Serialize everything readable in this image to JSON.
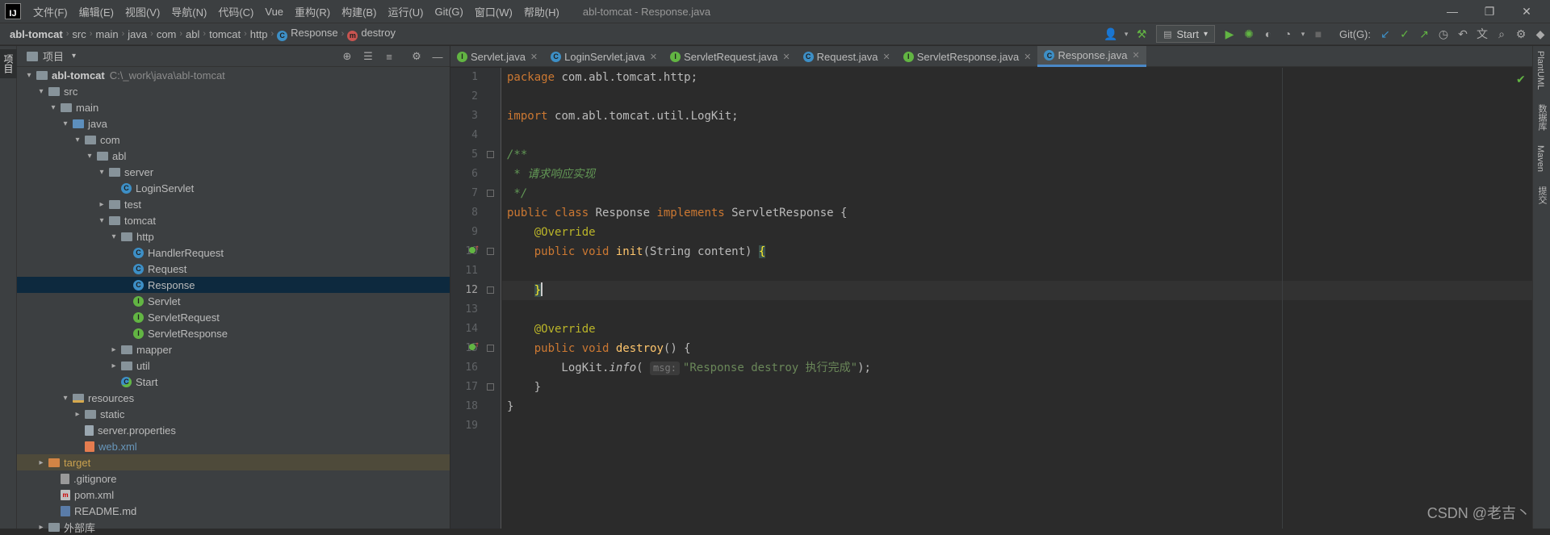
{
  "menubar": {
    "logo": "IJ",
    "items": [
      "文件(F)",
      "编辑(E)",
      "视图(V)",
      "导航(N)",
      "代码(C)",
      "Vue",
      "重构(R)",
      "构建(B)",
      "运行(U)",
      "Git(G)",
      "窗口(W)",
      "帮助(H)"
    ],
    "window_title": "abl-tomcat - Response.java"
  },
  "breadcrumb": {
    "items": [
      "abl-tomcat",
      "src",
      "main",
      "java",
      "com",
      "abl",
      "tomcat",
      "http",
      "Response",
      "destroy"
    ]
  },
  "toolbar": {
    "run_config": "Start",
    "git_label": "Git(G):"
  },
  "project_panel": {
    "title": "项目",
    "strip_label": "项目"
  },
  "tree": [
    {
      "label": "abl-tomcat",
      "hint": "C:\\_work\\java\\abl-tomcat",
      "depth": 0,
      "arrow": "▾",
      "icon": "root",
      "bold": true
    },
    {
      "label": "src",
      "depth": 1,
      "arrow": "▾",
      "icon": "folder"
    },
    {
      "label": "main",
      "depth": 2,
      "arrow": "▾",
      "icon": "folder"
    },
    {
      "label": "java",
      "depth": 3,
      "arrow": "▾",
      "icon": "folder-blue"
    },
    {
      "label": "com",
      "depth": 4,
      "arrow": "▾",
      "icon": "folder"
    },
    {
      "label": "abl",
      "depth": 5,
      "arrow": "▾",
      "icon": "folder"
    },
    {
      "label": "server",
      "depth": 6,
      "arrow": "▾",
      "icon": "folder"
    },
    {
      "label": "LoginServlet",
      "depth": 7,
      "arrow": "",
      "icon": "class"
    },
    {
      "label": "test",
      "depth": 6,
      "arrow": "▸",
      "icon": "folder"
    },
    {
      "label": "tomcat",
      "depth": 6,
      "arrow": "▾",
      "icon": "folder"
    },
    {
      "label": "http",
      "depth": 7,
      "arrow": "▾",
      "icon": "folder"
    },
    {
      "label": "HandlerRequest",
      "depth": 8,
      "arrow": "",
      "icon": "class"
    },
    {
      "label": "Request",
      "depth": 8,
      "arrow": "",
      "icon": "class"
    },
    {
      "label": "Response",
      "depth": 8,
      "arrow": "",
      "icon": "class",
      "selected": true
    },
    {
      "label": "Servlet",
      "depth": 8,
      "arrow": "",
      "icon": "interface"
    },
    {
      "label": "ServletRequest",
      "depth": 8,
      "arrow": "",
      "icon": "interface"
    },
    {
      "label": "ServletResponse",
      "depth": 8,
      "arrow": "",
      "icon": "interface"
    },
    {
      "label": "mapper",
      "depth": 7,
      "arrow": "▸",
      "icon": "folder"
    },
    {
      "label": "util",
      "depth": 7,
      "arrow": "▸",
      "icon": "folder"
    },
    {
      "label": "Start",
      "depth": 7,
      "arrow": "",
      "icon": "start"
    },
    {
      "label": "resources",
      "depth": 3,
      "arrow": "▾",
      "icon": "folder-res"
    },
    {
      "label": "static",
      "depth": 4,
      "arrow": "▸",
      "icon": "folder"
    },
    {
      "label": "server.properties",
      "depth": 4,
      "arrow": "",
      "icon": "text"
    },
    {
      "label": "web.xml",
      "depth": 4,
      "arrow": "",
      "icon": "xml",
      "color": "blue"
    },
    {
      "label": "target",
      "depth": 1,
      "arrow": "▸",
      "icon": "folder-orange",
      "color": "orange",
      "target": true
    },
    {
      "label": ".gitignore",
      "depth": 2,
      "arrow": "",
      "icon": "git"
    },
    {
      "label": "pom.xml",
      "depth": 2,
      "arrow": "",
      "icon": "maven"
    },
    {
      "label": "README.md",
      "depth": 2,
      "arrow": "",
      "icon": "md"
    },
    {
      "label": "外部库",
      "depth": 1,
      "arrow": "▸",
      "icon": "folder"
    }
  ],
  "editor_tabs": [
    {
      "label": "Servlet.java",
      "icon": "interface"
    },
    {
      "label": "LoginServlet.java",
      "icon": "class"
    },
    {
      "label": "ServletRequest.java",
      "icon": "interface"
    },
    {
      "label": "Request.java",
      "icon": "class"
    },
    {
      "label": "ServletResponse.java",
      "icon": "interface"
    },
    {
      "label": "Response.java",
      "icon": "class",
      "active": true
    }
  ],
  "code": {
    "line_numbers": [
      "1",
      "2",
      "3",
      "4",
      "5",
      "6",
      "7",
      "8",
      "9",
      "10",
      "11",
      "12",
      "13",
      "14",
      "15",
      "16",
      "17",
      "18",
      "19"
    ],
    "current_line": 12,
    "lines": [
      [
        {
          "t": "package ",
          "c": "kw"
        },
        {
          "t": "com.abl.tomcat.http;"
        }
      ],
      [],
      [
        {
          "t": "import ",
          "c": "kw"
        },
        {
          "t": "com.abl.tomcat.util.LogKit;"
        }
      ],
      [],
      [
        {
          "t": "/**",
          "c": "cmt"
        }
      ],
      [
        {
          "t": " * 请求响应实现",
          "c": "cmt"
        }
      ],
      [
        {
          "t": " */",
          "c": "cmt"
        }
      ],
      [
        {
          "t": "public class ",
          "c": "kw"
        },
        {
          "t": "Response "
        },
        {
          "t": "implements ",
          "c": "kw"
        },
        {
          "t": "ServletResponse {"
        }
      ],
      [
        {
          "t": "    "
        },
        {
          "t": "@Override",
          "c": "ann"
        }
      ],
      [
        {
          "t": "    "
        },
        {
          "t": "public void ",
          "c": "kw"
        },
        {
          "t": "init",
          "c": "fn"
        },
        {
          "t": "(String content) "
        },
        {
          "t": "{",
          "c": "bracket-hl"
        }
      ],
      [],
      [
        {
          "t": "    "
        },
        {
          "t": "}",
          "c": "bracket-hl"
        },
        {
          "caret": true
        }
      ],
      [],
      [
        {
          "t": "    "
        },
        {
          "t": "@Override",
          "c": "ann"
        }
      ],
      [
        {
          "t": "    "
        },
        {
          "t": "public void ",
          "c": "kw"
        },
        {
          "t": "destroy",
          "c": "fn"
        },
        {
          "t": "() {"
        }
      ],
      [
        {
          "t": "        LogKit."
        },
        {
          "t": "info",
          "c": "it"
        },
        {
          "t": "( "
        },
        {
          "hint": "msg:"
        },
        {
          "t": "\"Response destroy 执行完成\"",
          "c": "str"
        },
        {
          "t": ");"
        }
      ],
      [
        {
          "t": "    }"
        }
      ],
      [
        {
          "t": "}"
        }
      ],
      []
    ]
  },
  "right_strip": [
    "PlantUML",
    "数据库",
    "Maven",
    "提交"
  ],
  "watermark": "CSDN @老吉丶"
}
